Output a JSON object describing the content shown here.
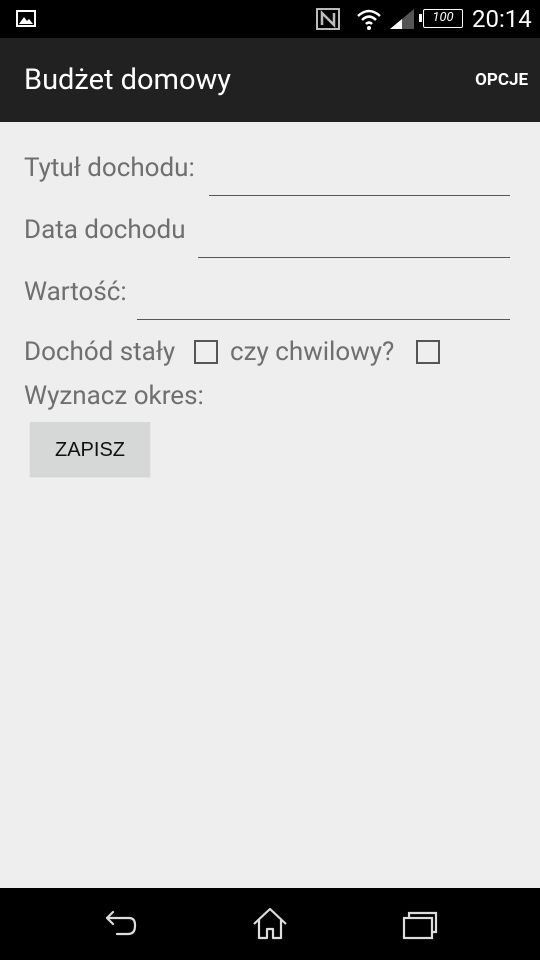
{
  "status_bar": {
    "battery": "100",
    "time": "20:14",
    "icons": [
      "gallery-icon",
      "nfc-icon",
      "wifi-icon",
      "signal-icon",
      "battery-icon"
    ]
  },
  "action_bar": {
    "title": "Budżet domowy",
    "menu": "OPCJE"
  },
  "form": {
    "title_label": "Tytuł dochodu:",
    "title_value": "",
    "date_label": "Data dochodu",
    "date_value": "",
    "value_label": "Wartość:",
    "value_value": "",
    "fixed_label": "Dochód stały",
    "fixed_checked": false,
    "temp_label": "czy chwilowy?",
    "temp_checked": false,
    "period_label": "Wyznacz okres:"
  },
  "buttons": {
    "save": "ZAPISZ"
  },
  "nav_bar": {
    "icons": [
      "back-icon",
      "home-icon",
      "recent-apps-icon"
    ]
  },
  "colors": {
    "background": "#eeeeee",
    "action_bar": "#212121",
    "label_text": "#6f6f6f",
    "button_bg": "#d6d7d7"
  }
}
